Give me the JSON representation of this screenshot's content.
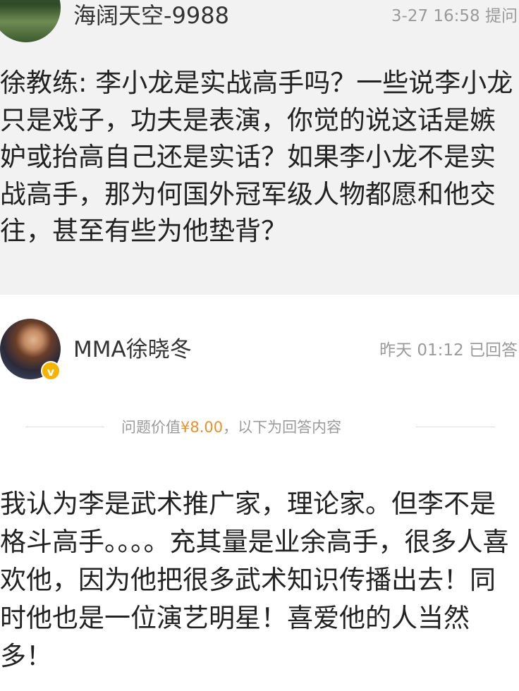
{
  "question": {
    "user": "海阔天空-9988",
    "meta": "3-27 16:58 提问",
    "text": "徐教练: 李小龙是实战高手吗？一些说李小龙只是戏子，功夫是表演，你觉的说这话是嫉妒或抬高自己还是实话？如果李小龙不是实战高手，那为何国外冠军级人物都愿和他交往，甚至有些为他垫背？"
  },
  "answerer": {
    "name": "MMA徐晓冬",
    "meta": "昨天 01:12 已回答",
    "badge": "v"
  },
  "divider": {
    "prefix": "问题价值",
    "amount": "¥8.00",
    "suffix": "，以下为回答内容"
  },
  "answer": {
    "text": "我认为李是武术推广家，理论家。但李不是格斗高手。。。。充其量是业余高手，很多人喜欢他，因为他把很多武术知识传播出去！同时他也是一位演艺明星！喜爱他的人当然多！"
  },
  "colors": {
    "question_bg": "#f2f2f2",
    "price_accent": "#e8912c",
    "muted_text": "#9a9a9a",
    "badge": "#f4b400"
  }
}
